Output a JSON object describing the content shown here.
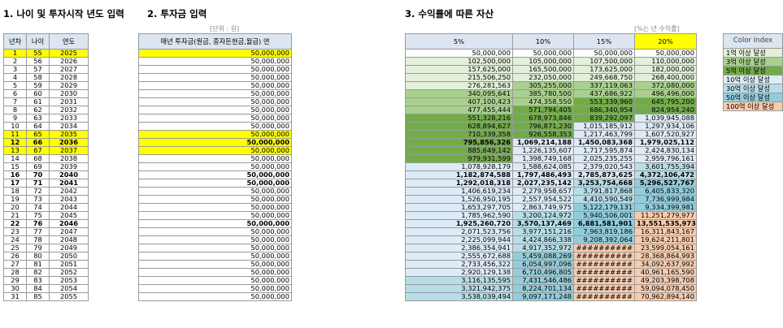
{
  "section1_title": "1. 나이 및 투자시작 년도 입력",
  "section2_title": "2. 투자금 입력",
  "section3_title": "3. 수익률에 따른 자산",
  "unit_note": "[단위 : 원]",
  "rate_note": "[%는 년 수익률]",
  "left_headers": {
    "year_no": "년차",
    "age": "나이",
    "year": "연도"
  },
  "invest_header": "매년 투자금(원금, 종자돈현금,월급) 연",
  "rate_headers": [
    "5%",
    "10%",
    "15%",
    "20%"
  ],
  "color_index": {
    "title": "Color Index",
    "items": [
      {
        "label": "1억 이상 달성",
        "color": "#e2efda"
      },
      {
        "label": "3억 이상 달성",
        "color": "#a9d08e"
      },
      {
        "label": "5억 이상 달성",
        "color": "#70ad47"
      },
      {
        "label": "10억 이상 달성",
        "color": "#ddebf7"
      },
      {
        "label": "30억 이상 달성",
        "color": "#b7dee8"
      },
      {
        "label": "50억 이상 달성",
        "color": "#92cddc"
      },
      {
        "label": "100억 이상 달성",
        "color": "#f8cbad"
      }
    ]
  },
  "rows": [
    {
      "n": "1",
      "age": "55",
      "year": "2025",
      "invest": "50,000,000",
      "v": [
        "50,000,000",
        "50,000,000",
        "50,000,000",
        "50,000,000"
      ]
    },
    {
      "n": "2",
      "age": "56",
      "year": "2026",
      "invest": "50,000,000",
      "v": [
        "102,500,000",
        "105,000,000",
        "107,500,000",
        "110,000,000"
      ]
    },
    {
      "n": "3",
      "age": "57",
      "year": "2027",
      "invest": "50,000,000",
      "v": [
        "157,625,000",
        "165,500,000",
        "173,625,000",
        "182,000,000"
      ]
    },
    {
      "n": "4",
      "age": "58",
      "year": "2028",
      "invest": "50,000,000",
      "v": [
        "215,506,250",
        "232,050,000",
        "249,668,750",
        "268,400,000"
      ]
    },
    {
      "n": "5",
      "age": "59",
      "year": "2029",
      "invest": "50,000,000",
      "v": [
        "276,281,563",
        "305,255,000",
        "337,119,063",
        "372,080,000"
      ]
    },
    {
      "n": "6",
      "age": "60",
      "year": "2030",
      "invest": "50,000,000",
      "v": [
        "340,095,641",
        "385,780,500",
        "437,686,922",
        "496,496,000"
      ]
    },
    {
      "n": "7",
      "age": "61",
      "year": "2031",
      "invest": "50,000,000",
      "v": [
        "407,100,423",
        "474,358,550",
        "553,339,960",
        "645,795,200"
      ]
    },
    {
      "n": "8",
      "age": "62",
      "year": "2032",
      "invest": "50,000,000",
      "v": [
        "477,455,444",
        "571,794,405",
        "686,340,954",
        "824,954,240"
      ]
    },
    {
      "n": "9",
      "age": "63",
      "year": "2033",
      "invest": "50,000,000",
      "v": [
        "551,328,216",
        "678,973,846",
        "839,292,097",
        "1,039,945,088"
      ]
    },
    {
      "n": "10",
      "age": "64",
      "year": "2034",
      "invest": "50,000,000",
      "v": [
        "628,894,627",
        "796,871,230",
        "1,015,185,912",
        "1,297,934,106"
      ]
    },
    {
      "n": "11",
      "age": "65",
      "year": "2035",
      "invest": "50,000,000",
      "v": [
        "710,339,358",
        "926,558,353",
        "1,217,463,799",
        "1,607,520,927"
      ]
    },
    {
      "n": "12",
      "age": "66",
      "year": "2036",
      "invest": "50,000,000",
      "v": [
        "795,856,326",
        "1,069,214,188",
        "1,450,083,368",
        "1,979,025,112"
      ]
    },
    {
      "n": "13",
      "age": "67",
      "year": "2037",
      "invest": "50,000,000",
      "v": [
        "885,649,142",
        "1,226,135,607",
        "1,717,595,874",
        "2,424,830,134"
      ]
    },
    {
      "n": "14",
      "age": "68",
      "year": "2038",
      "invest": "50,000,000",
      "v": [
        "979,931,599",
        "1,398,749,168",
        "2,025,235,255",
        "2,959,796,161"
      ]
    },
    {
      "n": "15",
      "age": "69",
      "year": "2039",
      "invest": "50,000,000",
      "v": [
        "1,078,928,179",
        "1,588,624,085",
        "2,379,020,543",
        "3,601,755,394"
      ]
    },
    {
      "n": "16",
      "age": "70",
      "year": "2040",
      "invest": "50,000,000",
      "v": [
        "1,182,874,588",
        "1,797,486,493",
        "2,785,873,625",
        "4,372,106,472"
      ]
    },
    {
      "n": "17",
      "age": "71",
      "year": "2041",
      "invest": "50,000,000",
      "v": [
        "1,292,018,318",
        "2,027,235,142",
        "3,253,754,668",
        "5,296,527,767"
      ]
    },
    {
      "n": "18",
      "age": "72",
      "year": "2042",
      "invest": "50,000,000",
      "v": [
        "1,406,619,234",
        "2,279,958,657",
        "3,791,817,868",
        "6,405,833,320"
      ]
    },
    {
      "n": "19",
      "age": "73",
      "year": "2043",
      "invest": "50,000,000",
      "v": [
        "1,526,950,195",
        "2,557,954,522",
        "4,410,590,549",
        "7,736,999,984"
      ]
    },
    {
      "n": "20",
      "age": "74",
      "year": "2044",
      "invest": "50,000,000",
      "v": [
        "1,653,297,705",
        "2,863,749,975",
        "5,122,179,131",
        "9,334,399,981"
      ]
    },
    {
      "n": "21",
      "age": "75",
      "year": "2045",
      "invest": "50,000,000",
      "v": [
        "1,785,962,590",
        "3,200,124,972",
        "5,940,506,001",
        "11,251,279,977"
      ]
    },
    {
      "n": "22",
      "age": "76",
      "year": "2046",
      "invest": "50,000,000",
      "v": [
        "1,925,260,720",
        "3,570,137,469",
        "6,881,581,901",
        "13,551,535,973"
      ]
    },
    {
      "n": "23",
      "age": "77",
      "year": "2047",
      "invest": "50,000,000",
      "v": [
        "2,071,523,756",
        "3,977,151,216",
        "7,963,819,186",
        "16,311,843,167"
      ]
    },
    {
      "n": "24",
      "age": "78",
      "year": "2048",
      "invest": "50,000,000",
      "v": [
        "2,225,099,944",
        "4,424,866,338",
        "9,208,392,064",
        "19,624,211,801"
      ]
    },
    {
      "n": "25",
      "age": "79",
      "year": "2049",
      "invest": "50,000,000",
      "v": [
        "2,386,354,941",
        "4,917,352,972",
        "##########",
        "23,599,054,161"
      ]
    },
    {
      "n": "26",
      "age": "80",
      "year": "2050",
      "invest": "50,000,000",
      "v": [
        "2,555,672,688",
        "5,459,088,269",
        "##########",
        "28,368,864,993"
      ]
    },
    {
      "n": "27",
      "age": "81",
      "year": "2051",
      "invest": "50,000,000",
      "v": [
        "2,733,456,322",
        "6,054,997,096",
        "##########",
        "34,092,637,992"
      ]
    },
    {
      "n": "28",
      "age": "82",
      "year": "2052",
      "invest": "50,000,000",
      "v": [
        "2,920,129,138",
        "6,710,496,805",
        "##########",
        "40,961,165,590"
      ]
    },
    {
      "n": "29",
      "age": "83",
      "year": "2053",
      "invest": "50,000,000",
      "v": [
        "3,116,135,595",
        "7,431,546,486",
        "##########",
        "49,203,398,708"
      ]
    },
    {
      "n": "30",
      "age": "84",
      "year": "2054",
      "invest": "50,000,000",
      "v": [
        "3,321,942,375",
        "8,224,701,134",
        "##########",
        "59,094,078,450"
      ]
    },
    {
      "n": "31",
      "age": "85",
      "year": "2055",
      "invest": "50,000,000",
      "v": [
        "3,538,039,494",
        "9,097,171,248",
        "##########",
        "70,962,894,140"
      ]
    }
  ],
  "highlight_rows": [
    1,
    11,
    12,
    13
  ],
  "bold_rows": [
    12,
    16,
    17,
    22
  ],
  "colors": {
    "header_bg": "#dce6f1",
    "highlight": "#ffff00",
    "lv1": "#e2efda",
    "lv3": "#a9d08e",
    "lv5": "#70ad47",
    "lv10": "#ddebf7",
    "lv30": "#b7dee8",
    "lv50": "#92cddc",
    "lv100": "#f8cbad"
  }
}
